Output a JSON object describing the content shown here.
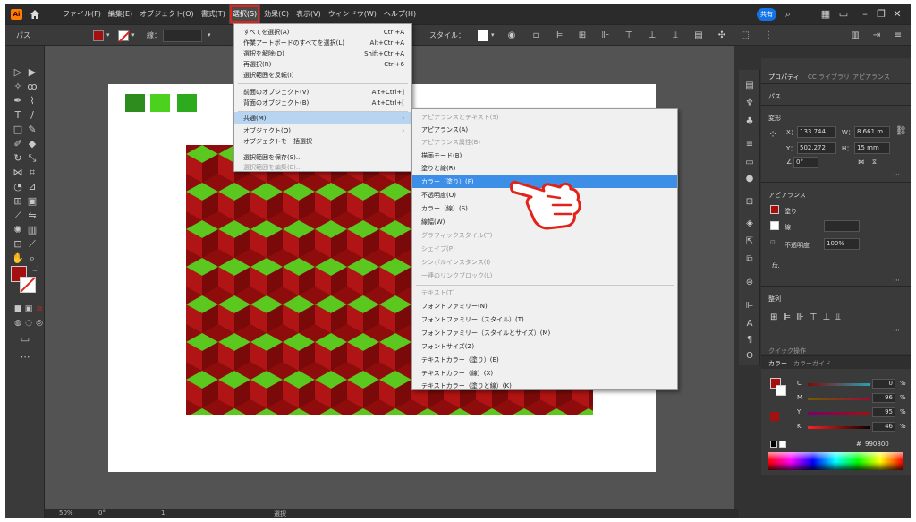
{
  "app": {
    "logo": "Ai"
  },
  "menubar": {
    "items": [
      "ファイル(F)",
      "編集(E)",
      "オブジェクト(O)",
      "書式(T)",
      "選択(S)",
      "効果(C)",
      "表示(V)",
      "ウィンドウ(W)",
      "ヘルプ(H)"
    ],
    "share_label": "共有"
  },
  "controlbar": {
    "label": "パス",
    "stroke_label": "線：",
    "style_label": "スタイル："
  },
  "colors": {
    "fill": "#a50f0f",
    "accent": "#e2231a",
    "highlight": "#3d8ee6",
    "green": "#5ac81e",
    "red": "#b01414"
  },
  "select_menu": {
    "items": [
      {
        "label": "すべてを選択(A)",
        "shortcut": "Ctrl+A"
      },
      {
        "label": "作業アートボードのすべてを選択(L)",
        "shortcut": "Alt+Ctrl+A"
      },
      {
        "label": "選択を解除(D)",
        "shortcut": "Shift+Ctrl+A"
      },
      {
        "label": "再選択(R)",
        "shortcut": "Ctrl+6"
      },
      {
        "label": "選択範囲を反転(I)",
        "shortcut": ""
      },
      {
        "label": "前面のオブジェクト(V)",
        "shortcut": "Alt+Ctrl+]"
      },
      {
        "label": "背面のオブジェクト(B)",
        "shortcut": "Alt+Ctrl+["
      },
      {
        "label": "共通(M)",
        "shortcut": ""
      },
      {
        "label": "オブジェクト(O)",
        "shortcut": ""
      },
      {
        "label": "オブジェクトを一括選択",
        "shortcut": ""
      },
      {
        "label": "選択範囲を保存(S)...",
        "shortcut": ""
      },
      {
        "label": "選択範囲を編集(E)...",
        "shortcut": ""
      }
    ]
  },
  "same_submenu": {
    "items": [
      "アピアランスとテキスト(S)",
      "アピアランス(A)",
      "アピアランス属性(B)",
      "描画モード(B)",
      "塗りと線(R)",
      "カラー（塗り）(F)",
      "不透明度(O)",
      "カラー（線）(S)",
      "線幅(W)",
      "グラフィックスタイル(T)",
      "シェイプ(P)",
      "シンボルインスタンス(I)",
      "一連のリンクブロック(L)",
      "テキスト(T)",
      "フォントファミリー(N)",
      "フォントファミリー（スタイル）(T)",
      "フォントファミリー（スタイルとサイズ）(M)",
      "フォントサイズ(Z)",
      "テキストカラー（塗り）(E)",
      "テキストカラー（線）(X)",
      "テキストカラー（塗りと線）(K)"
    ]
  },
  "properties_panel": {
    "tabs": [
      "プロパティ",
      "CC ライブラリ",
      "アピアランス"
    ],
    "object_type": "パス",
    "transform_title": "変形",
    "x_label": "X：",
    "x_value": "133.744",
    "y_label": "Y：",
    "y_value": "502.272",
    "w_label": "W：",
    "w_value": "8.661 m",
    "h_label": "H：",
    "h_value": "15 mm",
    "angle": "0°",
    "appearance_title": "アピアランス",
    "fill_label": "塗り",
    "stroke_label": "線",
    "opacity_label": "不透明度",
    "opacity_value": "100%",
    "fx": "fx.",
    "align_title": "整列",
    "quick_actions": "クイック操作"
  },
  "color_panel": {
    "tabs": [
      "カラー",
      "カラーガイド"
    ],
    "channels": [
      {
        "name": "C",
        "value": "0",
        "unit": "%"
      },
      {
        "name": "M",
        "value": "96",
        "unit": "%"
      },
      {
        "name": "Y",
        "value": "95",
        "unit": "%"
      },
      {
        "name": "K",
        "value": "46",
        "unit": "%"
      }
    ],
    "hex": "990800"
  },
  "statusbar": {
    "zoom": "50%",
    "rotation": "0°",
    "artboard": "1",
    "tool": "選択"
  }
}
